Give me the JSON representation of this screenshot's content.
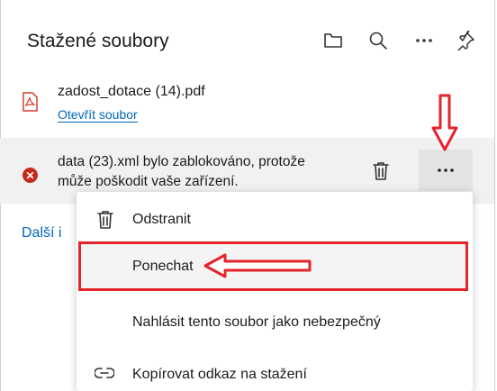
{
  "header": {
    "title": "Stažené soubory",
    "icons": [
      "folder-icon",
      "search-icon",
      "more-icon",
      "pin-icon"
    ]
  },
  "downloads": [
    {
      "filename": "zadost_dotace (14).pdf",
      "action_link": "Otevřít soubor",
      "icon": "pdf-icon"
    },
    {
      "message_line1": "data (23).xml bylo zablokováno, protože",
      "message_line2": "může poškodit vaše zařízení.",
      "icon": "error-icon"
    }
  ],
  "more_link": "Další i",
  "context_menu": {
    "items": [
      {
        "label": "Odstranit",
        "icon": "trash-icon"
      },
      {
        "label": "Ponechat",
        "icon": ""
      },
      {
        "label": "Nahlásit tento soubor jako nebezpečný",
        "icon": ""
      },
      {
        "label": "Kopírovat odkaz na stažení",
        "icon": "link-icon"
      }
    ],
    "highlighted": "Ponechat"
  },
  "colors": {
    "accent_link": "#0067b8",
    "annotation_red": "#e3242b",
    "error": "#c42b1c"
  }
}
